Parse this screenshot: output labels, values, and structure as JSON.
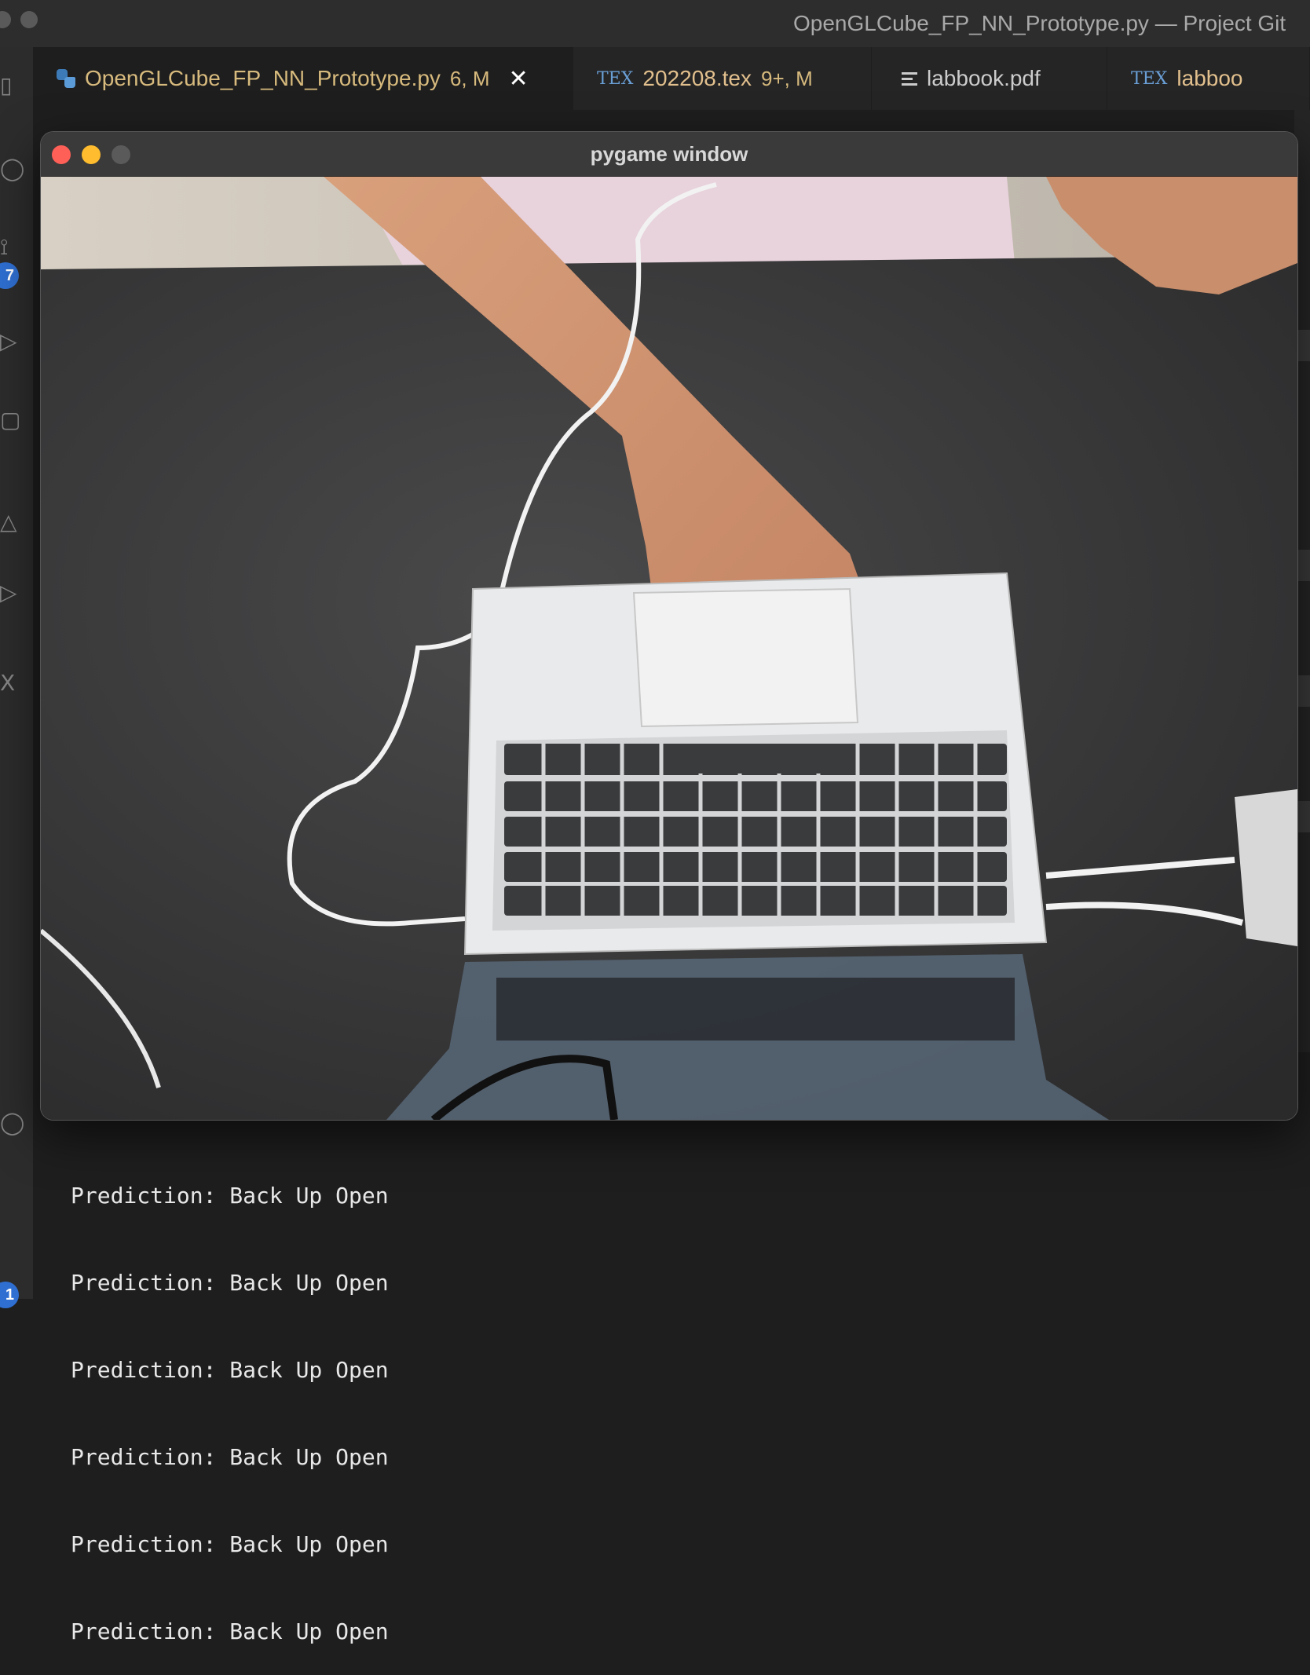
{
  "window": {
    "title": "OpenGLCube_FP_NN_Prototype.py — Project Git"
  },
  "activity_bar": {
    "badges": [
      "7",
      "1"
    ]
  },
  "tabs": [
    {
      "icon": "python-icon",
      "label": "OpenGLCube_FP_NN_Prototype.py",
      "status": "6, M",
      "active": true,
      "close": "✕"
    },
    {
      "icon": "tex-icon",
      "icon_text": "TEX",
      "label": "202208.tex",
      "status": "9+, M",
      "active": false
    },
    {
      "icon": "lines-icon",
      "label": "labbook.pdf",
      "status": "",
      "active": false
    },
    {
      "icon": "tex-icon",
      "icon_text": "TEX",
      "label": "labboo",
      "status": "",
      "active": false
    }
  ],
  "pygame_window": {
    "title": "pygame window",
    "traffic_colors": [
      "#fe5f57",
      "#febc2e",
      "#5a5a5a"
    ],
    "content": "webcam-feed"
  },
  "terminal": {
    "lines": [
      "Prediction: Back Up Open",
      "Prediction: Back Up Open",
      "Prediction: Back Up Open",
      "Prediction: Back Up Open",
      "Prediction: Back Up Open",
      "Prediction: Back Up Open"
    ]
  },
  "colors": {
    "modified_tab_text": "#d7ba7d",
    "editor_bg": "#1e1e1e",
    "badge_blue": "#2f6fd1"
  }
}
